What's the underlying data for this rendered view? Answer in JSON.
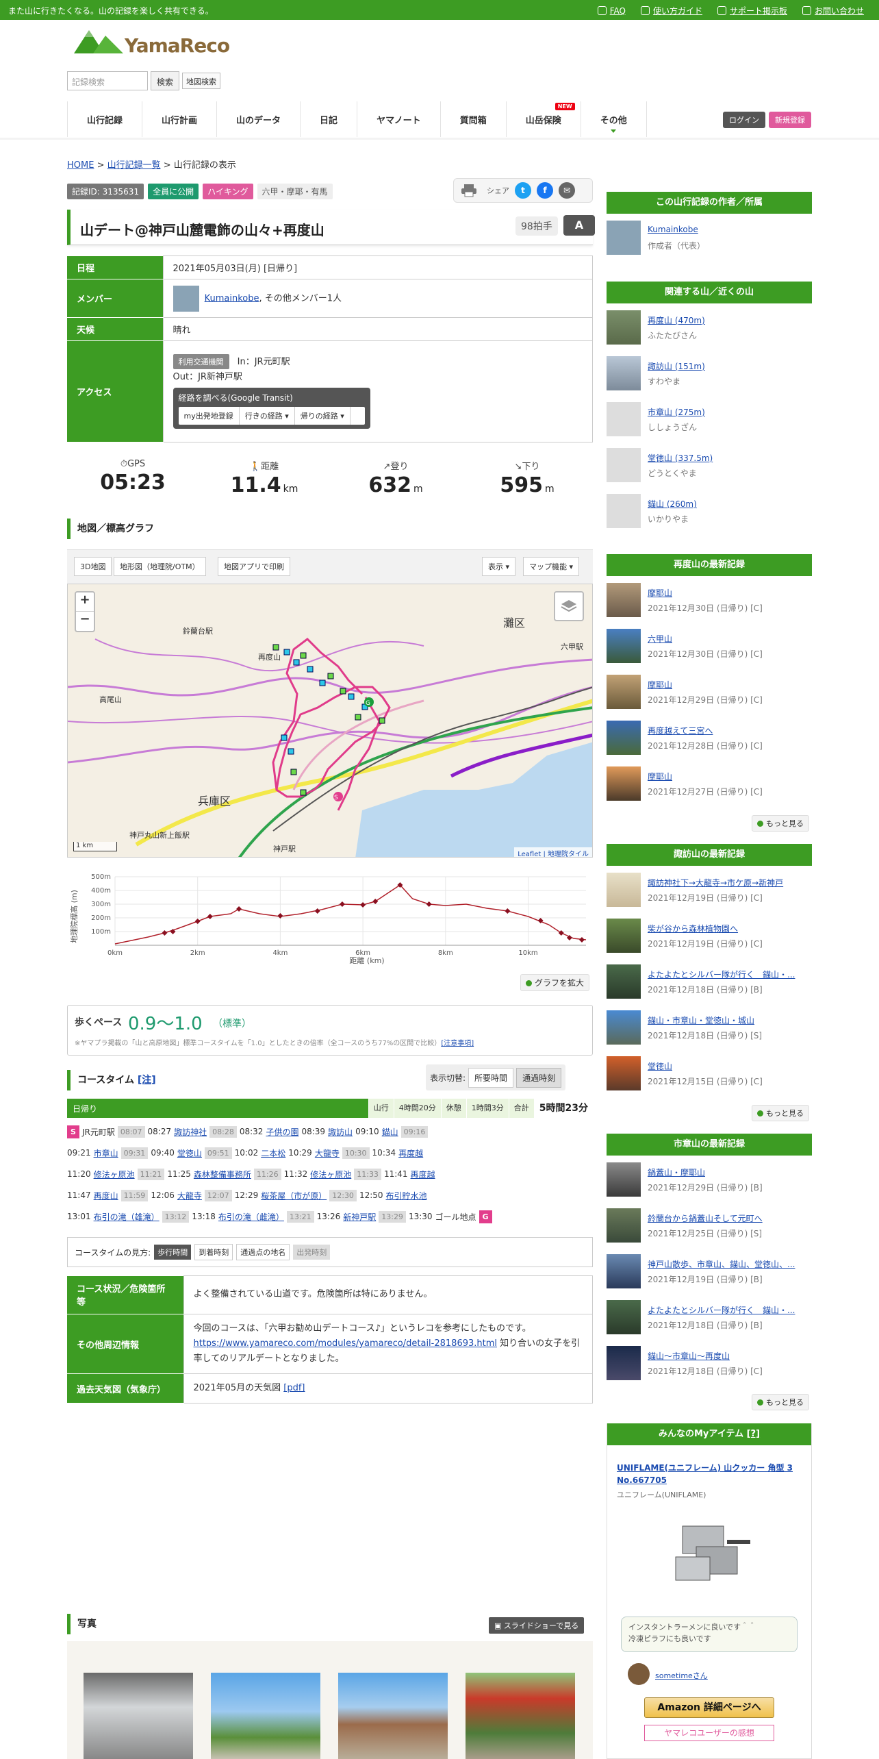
{
  "topbar": {
    "message": "また山に行きたくなる。山の記録を楽しく共有できる。",
    "links": [
      "FAQ",
      "使い方ガイド",
      "サポート掲示板",
      "お問い合わせ"
    ]
  },
  "logo": {
    "text": "YamaReco"
  },
  "search": {
    "placeholder": "記録検索",
    "button": "検索",
    "map_button": "地図検索"
  },
  "nav": {
    "items": [
      "山行記録",
      "山行計画",
      "山のデータ",
      "日記",
      "ヤマノート",
      "質問箱",
      "山岳保険",
      "その他"
    ],
    "new_badge": "NEW",
    "login": "ログイン",
    "register": "新規登録"
  },
  "breadcrumb": {
    "home": "HOME",
    "sep1": ">",
    "list": "山行記録一覧",
    "sep2": ">",
    "current": "山行記録の表示"
  },
  "badges": {
    "record_id": "記録ID: 3135631",
    "public": "全員に公開",
    "type": "ハイキング",
    "area": "六甲・摩耶・有馬"
  },
  "share": {
    "label": "シェア"
  },
  "record": {
    "title": "山デート@神戸山麓電飾の山々+再度山",
    "likes": "98拍手",
    "grade": "A"
  },
  "info": {
    "date_label": "日程",
    "date": "2021年05月03日(月) [日帰り]",
    "member_label": "メンバー",
    "member_name": "Kumainkobe",
    "member_other": ", その他メンバー1人",
    "weather_label": "天候",
    "weather": "晴れ",
    "access_label": "アクセス",
    "access_tag": "利用交通機関",
    "access_in": "In：JR元町駅",
    "access_out": "Out：JR新神戸駅",
    "transit_title": "経路を調べる(Google Transit)",
    "transit_buttons": [
      "my出発地登録",
      "行きの経路 ▾",
      "帰りの経路 ▾"
    ]
  },
  "stats": [
    {
      "label": "GPS",
      "value": "05:23",
      "unit": ""
    },
    {
      "label": "距離",
      "value": "11.4",
      "unit": "km"
    },
    {
      "label": "登り",
      "value": "632",
      "unit": "m"
    },
    {
      "label": "下り",
      "value": "595",
      "unit": "m"
    }
  ],
  "map_section": {
    "title": "地図／標高グラフ",
    "buttons": [
      "3D地図",
      "地形図（地理院/OTM）",
      "地図アプリで印刷"
    ],
    "right_buttons": [
      "表示 ▾",
      "マップ機能 ▾"
    ],
    "zoom_in": "+",
    "zoom_out": "−",
    "labels": [
      "鈴蘭台駅",
      "灘区",
      "再度山",
      "高尾山",
      "兵庫区",
      "神戸丸山新上飯駅",
      "神戸駅",
      "六甲駅"
    ],
    "scale": "1 km",
    "attribution": "Leaflet | 地理院タイル"
  },
  "chart_data": {
    "type": "line",
    "ylabel": "地理院標高 (m)",
    "xlabel": "距離 (km)",
    "x_ticks": [
      "0km",
      "2km",
      "4km",
      "6km",
      "8km",
      "10km"
    ],
    "y_ticks": [
      "100m",
      "200m",
      "300m",
      "400m",
      "500m"
    ],
    "xlim": [
      0,
      11.4
    ],
    "ylim": [
      0,
      500
    ],
    "x": [
      0,
      0.8,
      1.2,
      1.5,
      2.0,
      2.3,
      2.8,
      3.0,
      3.5,
      4.0,
      4.5,
      5.0,
      5.5,
      6.0,
      6.3,
      6.6,
      6.9,
      7.2,
      7.6,
      8.0,
      8.5,
      9.0,
      9.5,
      10.0,
      10.5,
      10.8,
      11.1,
      11.4
    ],
    "y": [
      10,
      60,
      90,
      120,
      175,
      210,
      230,
      265,
      230,
      210,
      230,
      260,
      300,
      295,
      320,
      380,
      440,
      340,
      300,
      290,
      300,
      270,
      250,
      210,
      150,
      90,
      50,
      40
    ],
    "markers_x": [
      1.2,
      1.4,
      2.0,
      2.3,
      3.0,
      4.0,
      4.9,
      5.5,
      6.0,
      6.3,
      6.9,
      7.6,
      9.5,
      10.3,
      10.8,
      11.0,
      11.3
    ],
    "markers_y": [
      90,
      100,
      175,
      210,
      265,
      215,
      250,
      300,
      295,
      320,
      440,
      300,
      250,
      180,
      90,
      55,
      40
    ],
    "expand_label": "グラフを拡大"
  },
  "pace": {
    "title": "歩くペース",
    "value": "0.9～1.0",
    "std": "（標準）",
    "note": "※ヤマプラ掲載の「山と高原地図」標準コースタイムを「1.0」としたときの倍率（全コースのうち77%の区間で比較）",
    "link": "[注意事項]"
  },
  "course": {
    "title": "コースタイム",
    "note_link": "[注]",
    "toggle_label": "表示切替:",
    "toggle": [
      "所要時間",
      "通過時刻"
    ],
    "bar_left": "日帰り",
    "bar_right": [
      "山行",
      "4時間20分",
      "休憩",
      "1時間3分",
      "合計"
    ],
    "total": "5時間23分",
    "rows": [
      [
        "S",
        "JR元町駅",
        "08:07",
        "08:27",
        "諏訪神社",
        "08:28",
        "08:32",
        "子供の園",
        "08:39",
        "諏訪山",
        "09:10",
        "錨山",
        "09:16"
      ],
      [
        "09:21",
        "市章山",
        "09:31",
        "09:40",
        "堂徳山",
        "09:51",
        "10:02",
        "二本松",
        "10:29",
        "大龍寺",
        "10:30",
        "10:34",
        "再度越"
      ],
      [
        "11:20",
        "修法ヶ原池",
        "11:21",
        "11:25",
        "森林整備事務所",
        "11:26",
        "11:32",
        "修法ヶ原池",
        "11:33",
        "11:41",
        "再度越"
      ],
      [
        "11:47",
        "再度山",
        "11:59",
        "12:06",
        "大龍寺",
        "12:07",
        "12:29",
        "桜茶屋（市が原）",
        "12:30",
        "12:50",
        "布引貯水池"
      ],
      [
        "13:01",
        "布引の滝（雄滝）",
        "13:12",
        "13:18",
        "布引の滝（雌滝）",
        "13:21",
        "13:26",
        "新神戸駅",
        "13:29",
        "13:30",
        "ゴール地点",
        "G"
      ]
    ],
    "legend_label": "コースタイムの見方:",
    "legend": [
      "歩行時間",
      "到着時刻",
      "通過点の地名",
      "出発時刻"
    ]
  },
  "info2": {
    "route_label": "コース状況／危険箇所等",
    "route": "よく整備されている山道です。危険箇所は特にありません。",
    "other_label": "その他周辺情報",
    "other_a": "今回のコースは、「六甲お勧め山デートコース♪」というレコを参考にしたものです。",
    "other_link": "https://www.yamareco.com/modules/yamareco/detail-2818693.html",
    "other_b": "知り合いの女子を引率してのリアルデートとなりました。",
    "weather_label": "過去天気図（気象庁）",
    "weather": "2021年05月の天気図",
    "weather_link": "[pdf]"
  },
  "photos": {
    "title": "写真",
    "slideshow": "スライドショーで見る"
  },
  "sidebar": {
    "author_head": "この山行記録の作者／所属",
    "author_name": "Kumainkobe",
    "author_role": "作成者（代表）",
    "mountains_head": "関連する山／近くの山",
    "mountains": [
      {
        "name": "再度山 (470m)",
        "kana": "ふたたびさん"
      },
      {
        "name": "諏訪山 (151m)",
        "kana": "すわやま"
      },
      {
        "name": "市章山 (275m)",
        "kana": "ししょうざん"
      },
      {
        "name": "堂徳山 (337.5m)",
        "kana": "どうとくやま"
      },
      {
        "name": "錨山 (260m)",
        "kana": "いかりやま"
      }
    ],
    "latest1_head": "再度山の最新記録",
    "latest1": [
      {
        "t": "摩耶山",
        "d": "2021年12月30日 (日帰り) [C]"
      },
      {
        "t": "六甲山",
        "d": "2021年12月30日 (日帰り) [C]"
      },
      {
        "t": "摩耶山",
        "d": "2021年12月29日 (日帰り) [C]"
      },
      {
        "t": "再度越えて三宮へ",
        "d": "2021年12月28日 (日帰り) [C]"
      },
      {
        "t": "摩耶山",
        "d": "2021年12月27日 (日帰り) [C]"
      }
    ],
    "latest2_head": "諏訪山の最新記録",
    "latest2": [
      {
        "t": "諏訪神社下→大龍寺→市ケ原→新神戸",
        "d": "2021年12月19日 (日帰り) [C]"
      },
      {
        "t": "柴が谷から森林植物園へ",
        "d": "2021年12月19日 (日帰り) [C]"
      },
      {
        "t": "よたよたとシルバー隊が行く　錨山・...",
        "d": "2021年12月18日 (日帰り) [B]"
      },
      {
        "t": "錨山・市章山・堂徳山・城山",
        "d": "2021年12月18日 (日帰り) [S]"
      },
      {
        "t": "堂徳山",
        "d": "2021年12月15日 (日帰り) [C]"
      }
    ],
    "latest3_head": "市章山の最新記録",
    "latest3": [
      {
        "t": "鍋蓋山・摩耶山",
        "d": "2021年12月29日 (日帰り) [B]"
      },
      {
        "t": "鈴蘭台から鍋蓋山そして元町へ",
        "d": "2021年12月25日 (日帰り) [S]"
      },
      {
        "t": "神戸山散歩、市章山、錨山、堂徳山、...",
        "d": "2021年12月19日 (日帰り) [B]"
      },
      {
        "t": "よたよたとシルバー隊が行く　錨山・...",
        "d": "2021年12月18日 (日帰り) [B]"
      },
      {
        "t": "錨山～市章山～再度山",
        "d": "2021年12月18日 (日帰り) [C]"
      }
    ],
    "more": "もっと見る",
    "items_head": "みんなのMyアイテム",
    "items_head_link": "[?]",
    "item_name": "UNIFLAME(ユニフレーム) 山クッカー 角型 3 No.667705",
    "item_brand": "ユニフレーム(UNIFLAME)",
    "item_comment1": "インスタントラーメンに良いです＾＾",
    "item_comment2": "冷凍ピラフにも良いです",
    "item_user": "sometimeさん",
    "amazon": "Amazon 詳細ページへ",
    "review": "ヤマレコユーザーの感想"
  }
}
